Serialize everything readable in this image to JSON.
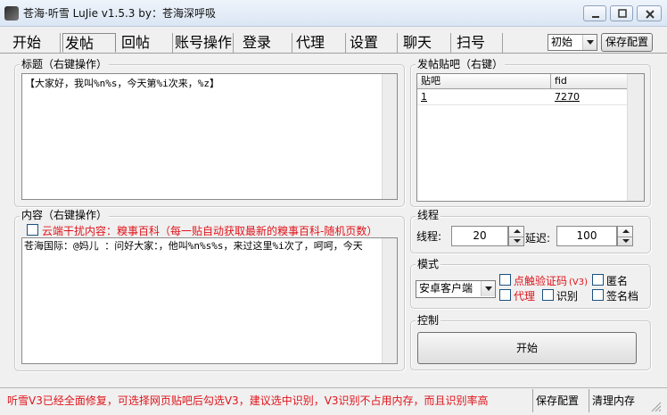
{
  "window": {
    "title": "苍海·听雪  LuJie  v1.5.3  by：苍海深呼吸"
  },
  "tabs": [
    {
      "label": "开始"
    },
    {
      "label": "发帖"
    },
    {
      "label": "回帖"
    },
    {
      "label": "账号操作"
    },
    {
      "label": "登录"
    },
    {
      "label": "代理"
    },
    {
      "label": "设置"
    },
    {
      "label": "聊天"
    },
    {
      "label": "扫号"
    }
  ],
  "active_tab": "发帖",
  "config": {
    "profile_selected": "初始",
    "save_label": "保存配置"
  },
  "title_panel": {
    "legend": "标题（右键操作）",
    "text": "【大家好，我叫%n%s，今天第%i次来，%z】"
  },
  "content_panel": {
    "legend": "内容（右键操作）",
    "cloud_label": "云端干扰内容：糗事百科（每一贴自动获取最新的糗事百科-随机页数）",
    "cloud_checked": false,
    "text": "苍海国际：@妈儿    ：问好大家：，他叫%n%s%s，来过这里%i次了，呵呵，今天"
  },
  "bars_panel": {
    "legend": "发帖贴吧（右键）",
    "columns": [
      "贴吧",
      "fid"
    ],
    "rows": [
      {
        "name": "1",
        "fid": "7270"
      }
    ]
  },
  "thread_panel": {
    "legend": "线程",
    "threads_label": "线程:",
    "threads_value": "20",
    "delay_label": "延迟:",
    "delay_value": "100"
  },
  "mode_panel": {
    "legend": "模式",
    "client_selected": "安卓客户端",
    "options": {
      "captcha": "点触验证码",
      "captcha_version": "(V3)",
      "anonymous": "匿名",
      "proxy": "代理",
      "recognize": "识别",
      "signature": "签名档"
    }
  },
  "control_panel": {
    "legend": "控制",
    "start_label": "开始"
  },
  "status": {
    "message": "听雪V3已经全面修复，可选择网页贴吧后勾选V3，建议选中识别，V3识别不占用内存，而且识别率高",
    "save_label": "保存配置",
    "clear_label": "清理内存"
  },
  "colors": {
    "warning_red": "#e0141b",
    "title_bar": "#dbe6f4"
  }
}
